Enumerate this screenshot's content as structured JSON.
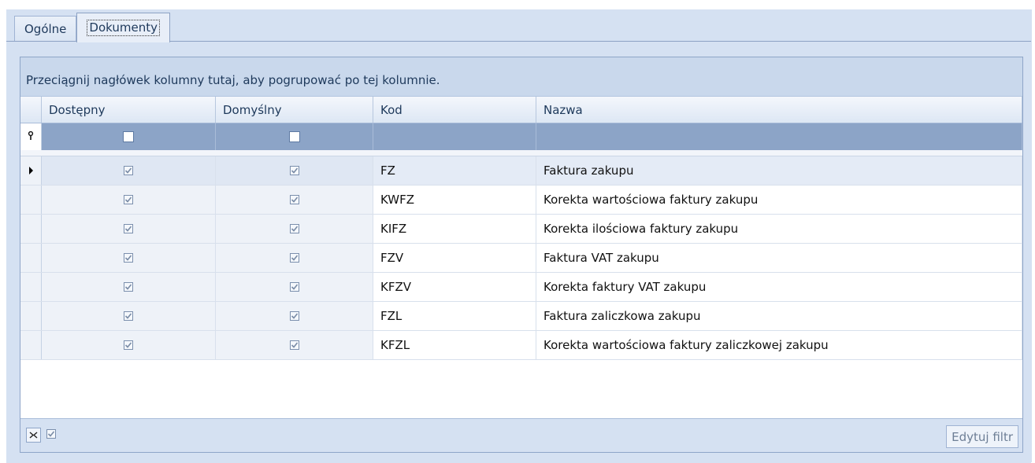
{
  "tabs": [
    {
      "label": "Ogólne",
      "active": false
    },
    {
      "label": "Dokumenty",
      "active": true
    }
  ],
  "grid": {
    "group_panel_text": "Przeciągnij nagłówek kolumny tutaj, aby pogrupować po tej kolumnie.",
    "columns": [
      "Dostępny",
      "Domyślny",
      "Kod",
      "Nazwa"
    ],
    "filter_row": {
      "available": false,
      "default": false
    },
    "rows": [
      {
        "available": true,
        "default": true,
        "code": "FZ",
        "name": "Faktura zakupu"
      },
      {
        "available": true,
        "default": true,
        "code": "KWFZ",
        "name": "Korekta wartościowa faktury zakupu"
      },
      {
        "available": true,
        "default": true,
        "code": "KIFZ",
        "name": "Korekta ilościowa faktury zakupu"
      },
      {
        "available": true,
        "default": true,
        "code": "FZV",
        "name": "Faktura VAT zakupu"
      },
      {
        "available": true,
        "default": true,
        "code": "KFZV",
        "name": "Korekta faktury VAT zakupu"
      },
      {
        "available": true,
        "default": true,
        "code": "FZL",
        "name": "Faktura zaliczkowa zakupu"
      },
      {
        "available": true,
        "default": true,
        "code": "KFZL",
        "name": "Korekta wartościowa faktury zaliczkowej zakupu"
      }
    ]
  },
  "footer": {
    "filter_enabled": true,
    "edit_filter_label": "Edytuj filtr"
  },
  "colors": {
    "background": "#d5e1f2",
    "filter_row": "#8ca4c7",
    "header_text": "#1e395b"
  }
}
